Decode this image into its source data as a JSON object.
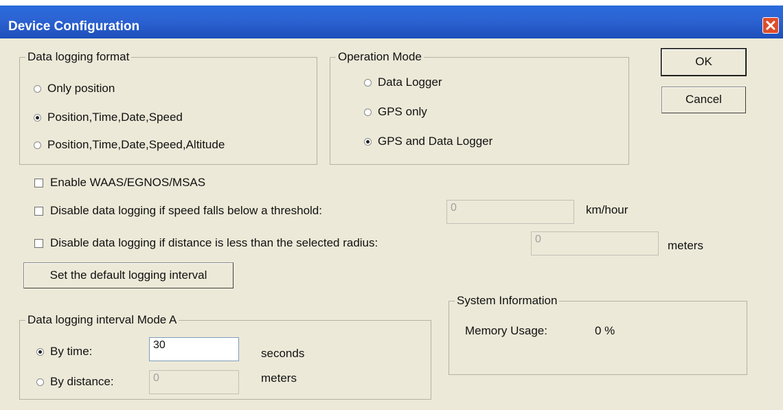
{
  "window": {
    "title": "Device Configuration",
    "close_icon": "close-icon"
  },
  "data_logging_format": {
    "legend": "Data logging format",
    "options": [
      {
        "label": "Only position",
        "selected": false
      },
      {
        "label": "Position,Time,Date,Speed",
        "selected": true
      },
      {
        "label": "Position,Time,Date,Speed,Altitude",
        "selected": false
      }
    ]
  },
  "operation_mode": {
    "legend": "Operation Mode",
    "options": [
      {
        "label": "Data Logger",
        "selected": false
      },
      {
        "label": "GPS only",
        "selected": false
      },
      {
        "label": "GPS and Data Logger",
        "selected": true
      }
    ]
  },
  "buttons": {
    "ok": "OK",
    "cancel": "Cancel",
    "default_interval": "Set the default logging interval"
  },
  "options": {
    "waas": {
      "label": "Enable WAAS/EGNOS/MSAS",
      "checked": false
    },
    "speed_threshold": {
      "label": "Disable data logging if speed falls below a threshold:",
      "checked": false,
      "value": "0",
      "unit": "km/hour"
    },
    "distance_radius": {
      "label": "Disable data logging if distance is less than the selected radius:",
      "checked": false,
      "value": "0",
      "unit": "meters"
    }
  },
  "interval_mode_a": {
    "legend": "Data logging interval Mode A",
    "by_time": {
      "label": "By time:",
      "selected": true,
      "value": "30",
      "unit": "seconds"
    },
    "by_distance": {
      "label": "By distance:",
      "selected": false,
      "value": "0",
      "unit": "meters"
    }
  },
  "system_information": {
    "legend": "System Information",
    "memory_label": "Memory Usage:",
    "memory_value": "0 %"
  }
}
